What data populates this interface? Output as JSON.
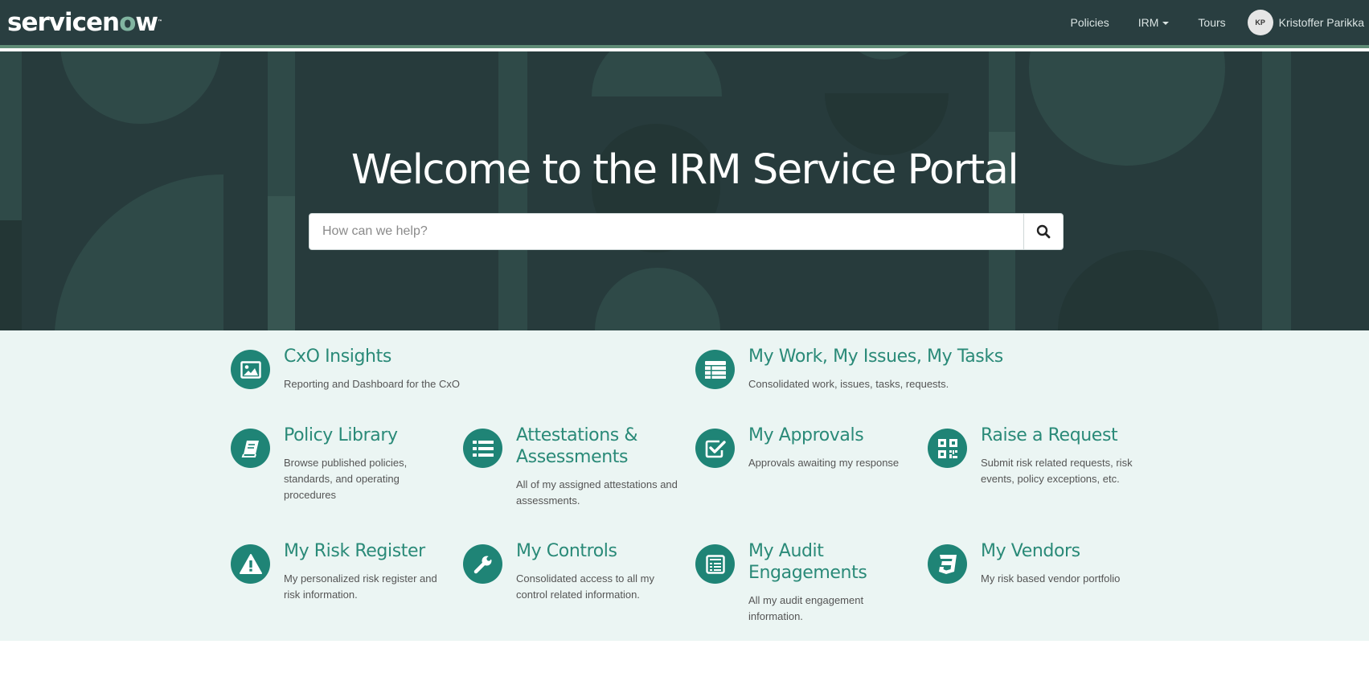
{
  "header": {
    "logo_text_a": "servicen",
    "logo_text_o": "o",
    "logo_text_b": "w",
    "logo_tm": "™",
    "nav": {
      "policies": "Policies",
      "irm": "IRM",
      "tours": "Tours"
    },
    "user": {
      "initials": "KP",
      "name": "Kristoffer Parikka"
    }
  },
  "hero": {
    "title": "Welcome to the IRM Service Portal",
    "search_placeholder": "How can we help?"
  },
  "tiles": {
    "cxo": {
      "title": "CxO Insights",
      "desc": "Reporting and Dashboard for the CxO",
      "icon": "picture-icon"
    },
    "mywork": {
      "title": "My Work, My Issues, My Tasks",
      "desc": "Consolidated work, issues, tasks, requests.",
      "icon": "table-icon"
    },
    "policy": {
      "title": "Policy Library",
      "desc": "Browse published policies, standards, and operating procedures",
      "icon": "book-icon"
    },
    "attest": {
      "title": "Attestations & Assessments",
      "desc": "All of my assigned attestations and assessments.",
      "icon": "list-icon"
    },
    "approvals": {
      "title": "My Approvals",
      "desc": "Approvals awaiting my response",
      "icon": "check-square-icon"
    },
    "request": {
      "title": "Raise a Request",
      "desc": "Submit risk related requests, risk events, policy exceptions, etc.",
      "icon": "qrcode-icon"
    },
    "risk": {
      "title": "My Risk Register",
      "desc": "My personalized risk register and risk information.",
      "icon": "warning-icon"
    },
    "controls": {
      "title": "My Controls",
      "desc": "Consolidated access to all my control related information.",
      "icon": "wrench-icon"
    },
    "audit": {
      "title": "My Audit Engagements",
      "desc": "All my audit engagement information.",
      "icon": "list-alt-icon"
    },
    "vendors": {
      "title": "My Vendors",
      "desc": "My risk based vendor portfolio",
      "icon": "css3-icon"
    }
  },
  "colors": {
    "header_bg": "#293e40",
    "accent": "#1f8476",
    "tiles_bg": "#ebf5f3",
    "title_text": "#2a8a78"
  }
}
